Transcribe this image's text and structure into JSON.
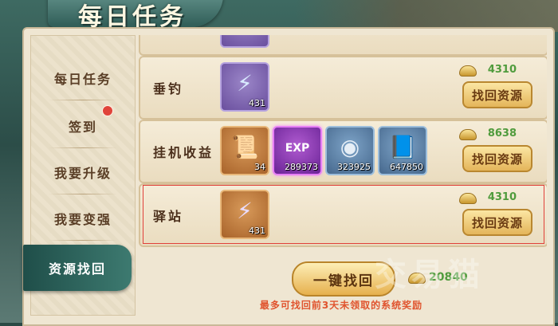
{
  "header": {
    "title": "每日任务"
  },
  "sidebar": {
    "tabs": [
      {
        "label": "每日任务"
      },
      {
        "label": "签到"
      },
      {
        "label": "我要升级"
      },
      {
        "label": "我要变强"
      },
      {
        "label": "资源找回"
      }
    ],
    "active_tab": "资源找回"
  },
  "rows": [
    {
      "name": "垂钓",
      "cost": "4310",
      "button": "找回资源",
      "items": [
        {
          "icon": "lightning-scroll-icon",
          "count": "431",
          "quality": "purple"
        }
      ]
    },
    {
      "name": "挂机收益",
      "cost": "8638",
      "button": "找回资源",
      "items": [
        {
          "icon": "talisman-icon",
          "count": "34",
          "quality": "orange"
        },
        {
          "icon": "exp-orb-icon",
          "count": "289373",
          "quality": "magenta"
        },
        {
          "icon": "coin-icon",
          "count": "323925",
          "quality": "blue"
        },
        {
          "icon": "scroll-icon",
          "count": "647850",
          "quality": "blue"
        }
      ]
    },
    {
      "name": "驿站",
      "cost": "4310",
      "button": "找回资源",
      "items": [
        {
          "icon": "lightning-scroll-icon",
          "count": "431",
          "quality": "orange"
        }
      ]
    }
  ],
  "footer": {
    "onekey_button": "一键找回",
    "total_cost": "20840",
    "note": "最多可找回前3天未领取的系统奖励"
  },
  "watermark": "交易猫",
  "colors": {
    "cost_green": "#4f9b3c",
    "note_red": "#e0542e",
    "active_tab": "#1f4e49"
  }
}
